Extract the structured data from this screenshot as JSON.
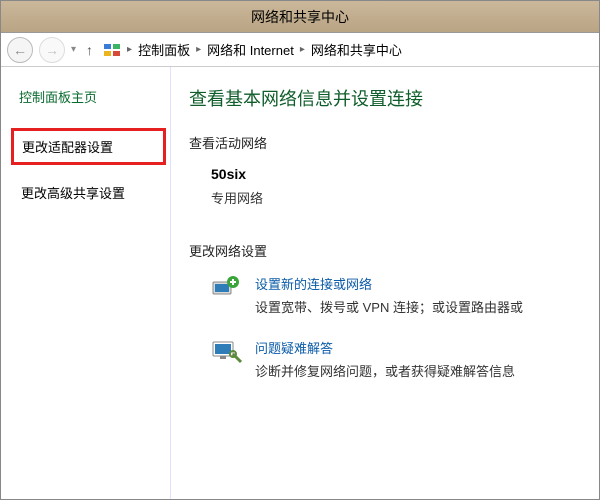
{
  "window": {
    "title": "网络和共享中心"
  },
  "nav": {
    "back_icon": "←",
    "forward_icon": "→",
    "up_icon": "↑",
    "breadcrumb": [
      "控制面板",
      "网络和 Internet",
      "网络和共享中心"
    ]
  },
  "sidebar": {
    "home": "控制面板主页",
    "links": [
      "更改适配器设置",
      "更改高级共享设置"
    ]
  },
  "content": {
    "heading": "查看基本网络信息并设置连接",
    "active_networks_title": "查看活动网络",
    "network": {
      "name": "50six",
      "type": "专用网络"
    },
    "change_settings_title": "更改网络设置",
    "items": [
      {
        "title": "设置新的连接或网络",
        "desc": "设置宽带、拨号或 VPN 连接；或设置路由器或"
      },
      {
        "title": "问题疑难解答",
        "desc": "诊断并修复网络问题，或者获得疑难解答信息"
      }
    ]
  }
}
